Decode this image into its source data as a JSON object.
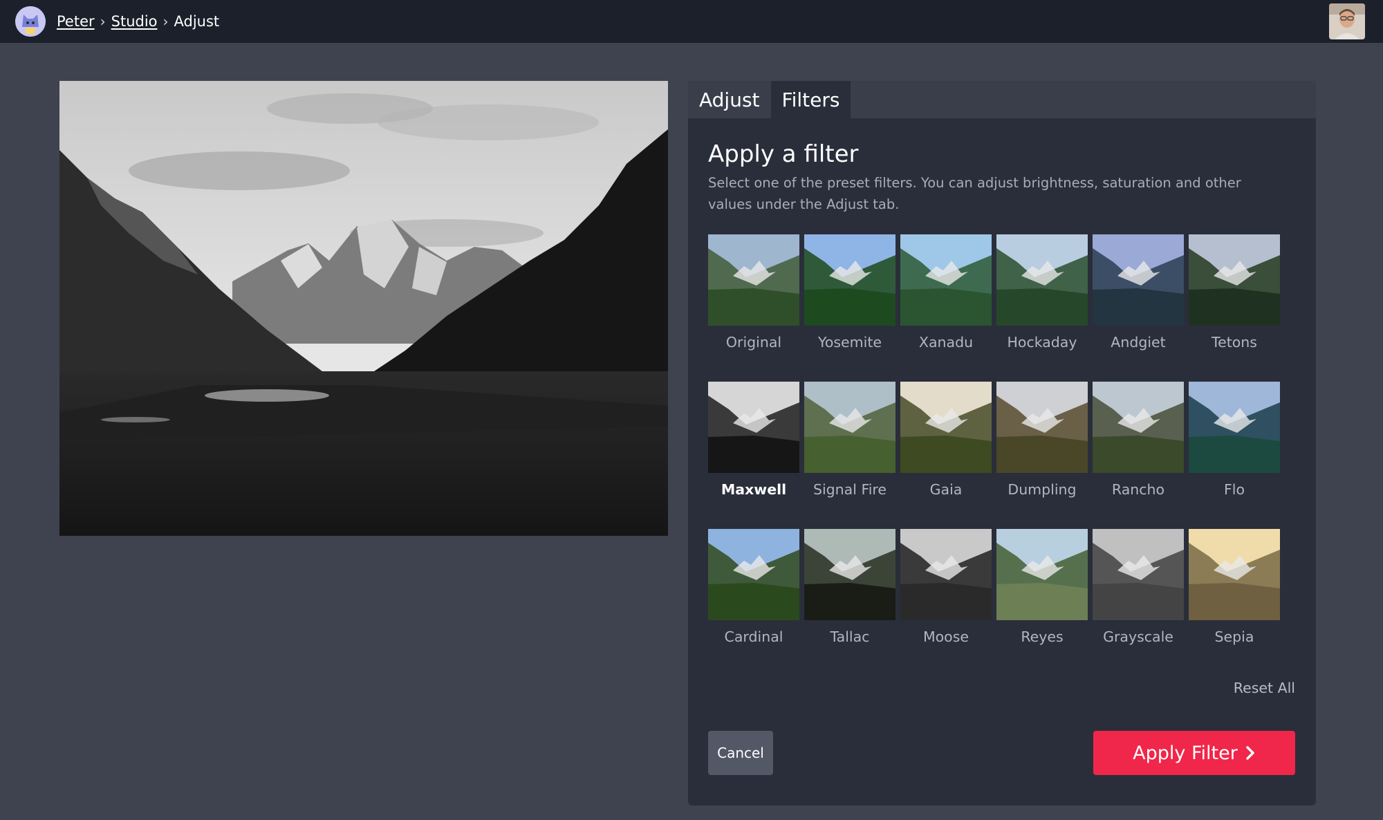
{
  "breadcrumb": {
    "items": [
      "Peter",
      "Studio",
      "Adjust"
    ],
    "separator": "›"
  },
  "tabs": [
    {
      "label": "Adjust",
      "active": false
    },
    {
      "label": "Filters",
      "active": true
    }
  ],
  "panel": {
    "title": "Apply a filter",
    "description": "Select one of the preset filters. You can adjust brightness, saturation and other values under the Adjust tab."
  },
  "filters": [
    {
      "name": "Original"
    },
    {
      "name": "Yosemite"
    },
    {
      "name": "Xanadu"
    },
    {
      "name": "Hockaday"
    },
    {
      "name": "Andgiet"
    },
    {
      "name": "Tetons"
    },
    {
      "name": "Maxwell",
      "selected": true
    },
    {
      "name": "Signal Fire"
    },
    {
      "name": "Gaia"
    },
    {
      "name": "Dumpling"
    },
    {
      "name": "Rancho"
    },
    {
      "name": "Flo"
    },
    {
      "name": "Cardinal"
    },
    {
      "name": "Tallac"
    },
    {
      "name": "Moose"
    },
    {
      "name": "Reyes"
    },
    {
      "name": "Grayscale"
    },
    {
      "name": "Sepia"
    }
  ],
  "actions": {
    "reset_all": "Reset All",
    "cancel": "Cancel",
    "apply": "Apply Filter",
    "apply_icon": "chevron-right-icon"
  },
  "colors": {
    "topbar": "#1c202b",
    "background": "#3f4350",
    "panel": "#2a2e3a",
    "accent": "#f0264a"
  }
}
